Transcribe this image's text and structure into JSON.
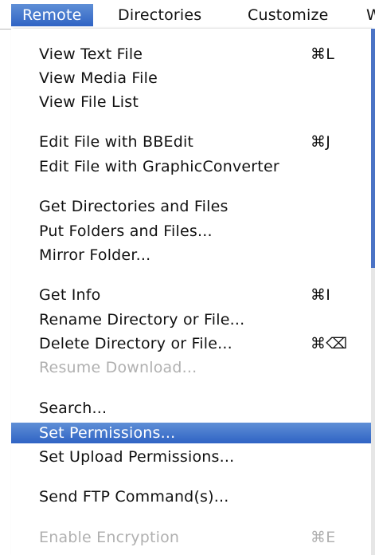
{
  "menubar": {
    "items": [
      {
        "label": "Remote"
      },
      {
        "label": "Directories"
      },
      {
        "label": "Customize"
      },
      {
        "label": "W"
      }
    ]
  },
  "menu": {
    "items": [
      {
        "label": "View Text File",
        "shortcut": "⌘L"
      },
      {
        "label": "View Media File",
        "shortcut": ""
      },
      {
        "label": "View File List",
        "shortcut": ""
      },
      {
        "label": "Edit File with BBEdit",
        "shortcut": "⌘J"
      },
      {
        "label": "Edit File with GraphicConverter",
        "shortcut": ""
      },
      {
        "label": "Get Directories and Files",
        "shortcut": ""
      },
      {
        "label": "Put Folders and Files...",
        "shortcut": ""
      },
      {
        "label": "Mirror Folder...",
        "shortcut": ""
      },
      {
        "label": "Get Info",
        "shortcut": "⌘I"
      },
      {
        "label": "Rename Directory or File...",
        "shortcut": ""
      },
      {
        "label": "Delete Directory or File...",
        "shortcut": "⌘⌫"
      },
      {
        "label": "Resume Download...",
        "shortcut": ""
      },
      {
        "label": "Search...",
        "shortcut": ""
      },
      {
        "label": "Set Permissions...",
        "shortcut": ""
      },
      {
        "label": "Set Upload Permissions...",
        "shortcut": ""
      },
      {
        "label": "Send FTP Command(s)...",
        "shortcut": ""
      },
      {
        "label": "Enable Encryption",
        "shortcut": "⌘E"
      }
    ]
  },
  "colors": {
    "highlight": "#2f63c4",
    "disabled_text": "#b0b0b0"
  }
}
